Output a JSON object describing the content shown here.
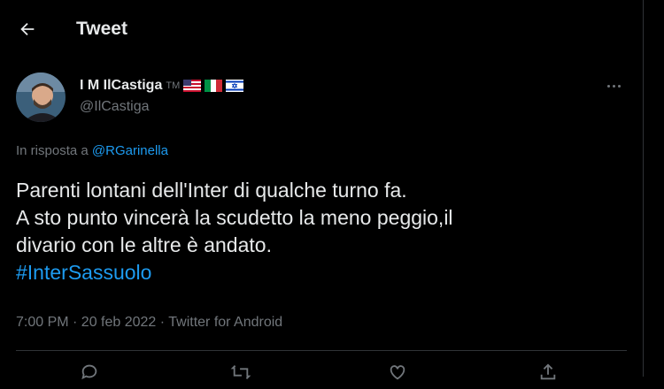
{
  "header": {
    "title": "Tweet",
    "back_icon": "back-arrow-icon"
  },
  "author": {
    "display_name": "I M IlCastiga",
    "tm": "TM",
    "flags": [
      "us-flag-icon",
      "italy-flag-icon",
      "israel-flag-icon"
    ],
    "handle": "@IlCastiga"
  },
  "reply_context": {
    "prefix": "In risposta a",
    "mention": "@RGarinella"
  },
  "tweet": {
    "lines": [
      "Parenti lontani dell'Inter di qualche turno fa.",
      "A sto punto vincerà la scudetto la meno peggio,il",
      "divario con le altre è andato."
    ],
    "hashtag": "#InterSassuolo"
  },
  "meta": "7:00 PM · 20 feb 2022 · Twitter for Android",
  "colors": {
    "accent": "#1d9bf0",
    "secondary_text": "#71767b",
    "background": "#000000"
  }
}
